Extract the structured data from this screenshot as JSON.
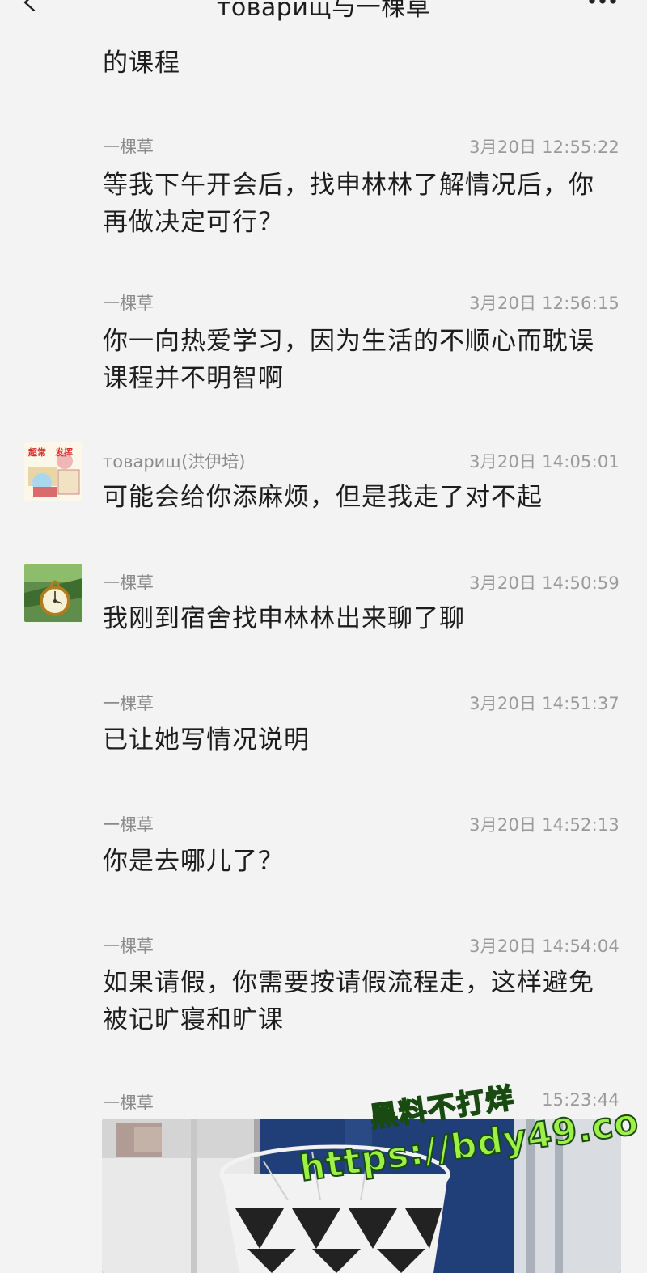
{
  "header": {
    "title": "товарищ与一棵草",
    "back_icon": "chevron-left-icon",
    "more_icon": "more-horizontal-icon"
  },
  "messages": [
    {
      "continuation_text": "的课程"
    },
    {
      "sender": "一棵草",
      "time": "3月20日 12:55:22",
      "text": "等我下午开会后，找申林林了解情况后，你再做决定可行？"
    },
    {
      "sender": "一棵草",
      "time": "3月20日 12:56:15",
      "text": "你一向热爱学习，因为生活的不顺心而耽误课程并不明智啊"
    },
    {
      "sender": "товарищ(洪伊培)",
      "time": "3月20日 14:05:01",
      "text": "可能会给你添麻烦，但是我走了对不起",
      "avatar": "sticker-avatar"
    },
    {
      "sender": "一棵草",
      "time": "3月20日 14:50:59",
      "text": "我刚到宿舍找申林林出来聊了聊",
      "avatar": "pocket-watch-avatar"
    },
    {
      "sender": "一棵草",
      "time": "3月20日 14:51:37",
      "text": "已让她写情况说明"
    },
    {
      "sender": "一棵草",
      "time": "3月20日 14:52:13",
      "text": "你是去哪儿了？"
    },
    {
      "sender": "一棵草",
      "time": "3月20日 14:54:04",
      "text": "如果请假，你需要按请假流程走，这样避免被记旷寝和旷课"
    },
    {
      "sender": "一棵草",
      "time": "15:23:44",
      "image": "dorm-photo"
    }
  ],
  "watermark": {
    "line1": "黑料不打烊",
    "line2": "https://bdy49.co"
  },
  "colors": {
    "background": "#f3f3f3",
    "text": "#1d1d1d",
    "meta": "#8a8a8a",
    "watermark": "#9df046"
  }
}
